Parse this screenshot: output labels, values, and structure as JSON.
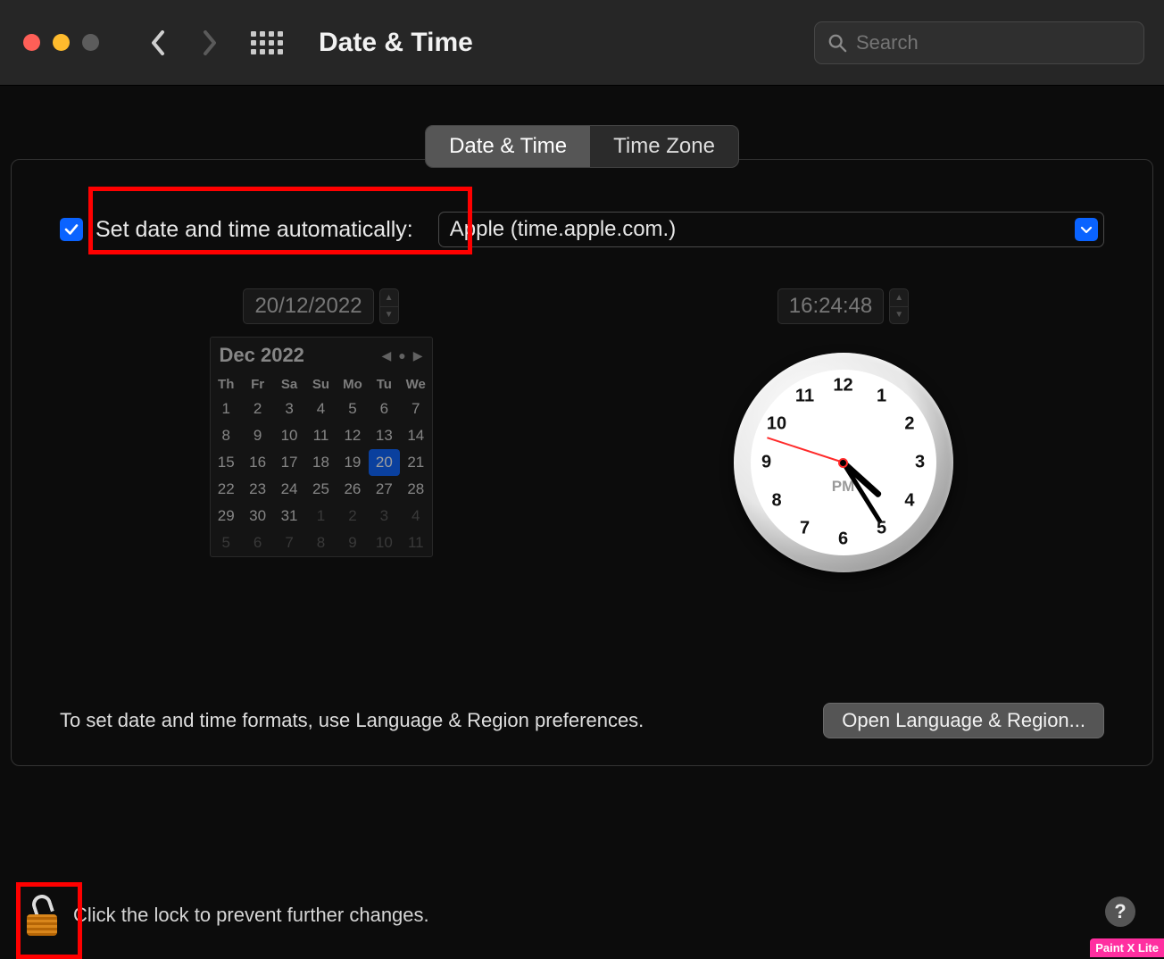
{
  "toolbar": {
    "title": "Date & Time",
    "search_placeholder": "Search"
  },
  "tabs": {
    "datetime": "Date & Time",
    "timezone": "Time Zone"
  },
  "auto": {
    "label": "Set date and time automatically:",
    "server": "Apple (time.apple.com.)",
    "checked": true
  },
  "date_field": "20/12/2022",
  "time_field": "16:24:48",
  "calendar": {
    "month": "Dec 2022",
    "weekdays": [
      "Th",
      "Fr",
      "Sa",
      "Su",
      "Mo",
      "Tu",
      "We"
    ],
    "leading_dim": [],
    "days": [
      1,
      2,
      3,
      4,
      5,
      6,
      7,
      8,
      9,
      10,
      11,
      12,
      13,
      14,
      15,
      16,
      17,
      18,
      19,
      20,
      21,
      22,
      23,
      24,
      25,
      26,
      27,
      28,
      29,
      30,
      31
    ],
    "selected": 20,
    "trailing_dim": [
      1,
      2,
      3,
      4,
      5,
      6,
      7,
      8,
      9,
      10,
      11
    ]
  },
  "clock": {
    "ampm": "PM",
    "hour_angle": 132,
    "minute_angle": 148,
    "second_angle": 288
  },
  "formats": {
    "text": "To set date and time formats, use Language & Region preferences.",
    "button": "Open Language & Region..."
  },
  "lock": {
    "text": "Click the lock to prevent further changes."
  },
  "help": "?",
  "watermark": "Paint X Lite"
}
